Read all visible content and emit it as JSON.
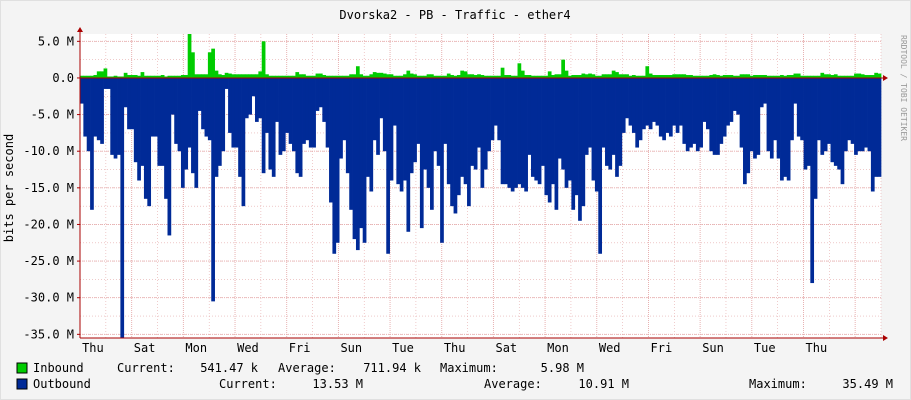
{
  "chart_data": {
    "type": "area",
    "title": "Dvorska2 - PB - Traffic - ether4",
    "ylabel": "bits per second",
    "watermark": "RRDTOOL / TOBI OETIKER",
    "ylim": [
      -35.5,
      6.0
    ],
    "y_ticks": [
      {
        "value": 5.0,
        "label": "5.0 M"
      },
      {
        "value": 0.0,
        "label": "0.0"
      },
      {
        "value": -5.0,
        "label": "-5.0 M"
      },
      {
        "value": -10.0,
        "label": "-10.0 M"
      },
      {
        "value": -15.0,
        "label": "-15.0 M"
      },
      {
        "value": -20.0,
        "label": "-20.0 M"
      },
      {
        "value": -25.0,
        "label": "-25.0 M"
      },
      {
        "value": -30.0,
        "label": "-30.0 M"
      },
      {
        "value": -35.0,
        "label": "-35.0 M"
      }
    ],
    "x_ticks": [
      "Thu",
      "Sat",
      "Mon",
      "Wed",
      "Fri",
      "Sun",
      "Tue",
      "Thu",
      "Sat",
      "Mon",
      "Wed",
      "Fri",
      "Sun",
      "Tue",
      "Thu"
    ],
    "colors": {
      "inbound": "#00cc00",
      "outbound": "#002a97",
      "grid": "#e5aaaa",
      "axis": "#aa0000",
      "bg": "#ffffff"
    },
    "series": [
      {
        "name": "Inbound",
        "values": [
          0.3,
          0.3,
          0.3,
          0.3,
          0.4,
          0.9,
          0.9,
          1.3,
          0.2,
          0.2,
          0.3,
          0.2,
          0.2,
          0.7,
          0.4,
          0.4,
          0.4,
          0.3,
          0.8,
          0.3,
          0.3,
          0.3,
          0.3,
          0.3,
          0.4,
          0.2,
          0.3,
          0.3,
          0.3,
          0.3,
          0.4,
          0.4,
          6.0,
          3.5,
          0.5,
          0.5,
          0.5,
          0.5,
          3.5,
          4.0,
          1.0,
          0.5,
          0.4,
          0.7,
          0.6,
          0.5,
          0.5,
          0.5,
          0.5,
          0.5,
          0.5,
          0.5,
          0.5,
          0.9,
          5.0,
          0.5,
          0.3,
          0.3,
          0.3,
          0.3,
          0.3,
          0.3,
          0.3,
          0.3,
          0.8,
          0.5,
          0.5,
          0.3,
          0.3,
          0.3,
          0.6,
          0.6,
          0.4,
          0.3,
          0.3,
          0.3,
          0.3,
          0.3,
          0.3,
          0.3,
          0.5,
          0.5,
          1.6,
          0.5,
          0.3,
          0.3,
          0.5,
          0.8,
          0.7,
          0.7,
          0.6,
          0.5,
          0.5,
          0.3,
          0.3,
          0.3,
          0.5,
          1.0,
          0.6,
          0.5,
          0.3,
          0.3,
          0.3,
          0.5,
          0.5,
          0.3,
          0.3,
          0.3,
          0.3,
          0.6,
          0.4,
          0.3,
          0.4,
          1.0,
          0.9,
          0.5,
          0.5,
          0.4,
          0.5,
          0.4,
          0.3,
          0.3,
          0.3,
          0.3,
          0.3,
          1.4,
          0.4,
          0.4,
          0.3,
          0.3,
          2.0,
          1.0,
          0.4,
          0.4,
          0.3,
          0.3,
          0.3,
          0.3,
          0.3,
          0.9,
          0.4,
          0.5,
          0.5,
          2.5,
          1.0,
          0.3,
          0.4,
          0.4,
          0.4,
          0.6,
          0.5,
          0.6,
          0.5,
          0.3,
          0.3,
          0.5,
          0.5,
          0.5,
          1.0,
          0.8,
          0.5,
          0.5,
          0.5,
          0.3,
          0.4,
          0.3,
          0.3,
          0.3,
          1.6,
          0.6,
          0.4,
          0.4,
          0.4,
          0.4,
          0.4,
          0.4,
          0.5,
          0.5,
          0.5,
          0.5,
          0.4,
          0.4,
          0.3,
          0.3,
          0.3,
          0.3,
          0.3,
          0.4,
          0.5,
          0.4,
          0.3,
          0.4,
          0.4,
          0.4,
          0.3,
          0.3,
          0.5,
          0.5,
          0.5,
          0.3,
          0.4,
          0.4,
          0.4,
          0.4,
          0.3,
          0.3,
          0.3,
          0.3,
          0.4,
          0.3,
          0.4,
          0.4,
          0.6,
          0.6,
          0.3,
          0.3,
          0.3,
          0.3,
          0.3,
          0.3,
          0.7,
          0.5,
          0.5,
          0.4,
          0.5,
          0.3,
          0.3,
          0.3,
          0.3,
          0.3,
          0.6,
          0.6,
          0.5,
          0.4,
          0.4,
          0.4,
          0.7,
          0.6,
          0.3,
          0.3,
          0.3,
          0.3,
          0.3,
          0.3,
          0.3,
          0.5,
          0.7,
          0.6,
          0.5,
          0.5,
          0.3,
          0.3
        ]
      },
      {
        "name": "Outbound",
        "values": [
          -3.5,
          -8.0,
          -10.0,
          -18.0,
          -8.0,
          -8.5,
          -9.0,
          -1.5,
          -1.5,
          -10.5,
          -11.0,
          -10.5,
          -35.5,
          -4.0,
          -7.0,
          -7.0,
          -11.5,
          -14.0,
          -12.0,
          -16.5,
          -17.5,
          -8.0,
          -8.0,
          -12.0,
          -12.0,
          -16.5,
          -21.5,
          -5.0,
          -9.0,
          -10.0,
          -15.0,
          -12.5,
          -9.5,
          -13.0,
          -15.0,
          -4.5,
          -7.0,
          -8.0,
          -8.5,
          -30.5,
          -13.5,
          -12.0,
          -10.0,
          -1.5,
          -7.5,
          -9.5,
          -9.5,
          -13.5,
          -17.5,
          -5.5,
          -5.0,
          -2.5,
          -6.0,
          -5.5,
          -13.0,
          -7.5,
          -12.5,
          -13.5,
          -6.0,
          -10.5,
          -10.0,
          -7.5,
          -9.0,
          -10.0,
          -13.0,
          -13.5,
          -9.0,
          -8.5,
          -9.5,
          -9.5,
          -4.5,
          -4.0,
          -6.0,
          -9.5,
          -17.0,
          -24.0,
          -22.5,
          -11.0,
          -8.5,
          -13.0,
          -18.0,
          -22.0,
          -23.5,
          -20.5,
          -22.5,
          -13.5,
          -15.5,
          -8.5,
          -10.5,
          -5.5,
          -10.0,
          -24.0,
          -14.0,
          -6.5,
          -14.5,
          -15.5,
          -14.0,
          -21.0,
          -13.0,
          -11.5,
          -9.0,
          -20.5,
          -12.5,
          -15.0,
          -18.0,
          -10.0,
          -12.0,
          -22.5,
          -9.0,
          -14.5,
          -17.5,
          -18.5,
          -16.0,
          -13.5,
          -14.5,
          -17.5,
          -12.0,
          -12.5,
          -9.5,
          -15.0,
          -12.5,
          -10.0,
          -8.5,
          -6.5,
          -8.5,
          -14.5,
          -14.5,
          -15.0,
          -15.5,
          -15.0,
          -14.5,
          -15.0,
          -15.5,
          -10.5,
          -13.5,
          -14.0,
          -14.5,
          -12.0,
          -16.0,
          -17.0,
          -14.5,
          -18.0,
          -11.0,
          -12.5,
          -15.0,
          -14.0,
          -18.0,
          -16.0,
          -19.5,
          -17.5,
          -10.5,
          -9.5,
          -14.0,
          -15.5,
          -24.0,
          -9.5,
          -12.0,
          -12.5,
          -10.5,
          -13.5,
          -12.0,
          -7.5,
          -5.5,
          -6.5,
          -7.5,
          -9.5,
          -8.5,
          -7.0,
          -6.5,
          -7.0,
          -6.0,
          -6.5,
          -8.0,
          -8.5,
          -7.5,
          -8.0,
          -6.5,
          -7.5,
          -6.5,
          -9.0,
          -10.0,
          -9.5,
          -9.0,
          -10.0,
          -9.5,
          -6.0,
          -7.0,
          -10.0,
          -10.5,
          -10.5,
          -9.0,
          -8.0,
          -6.5,
          -6.0,
          -4.5,
          -5.0,
          -9.5,
          -14.5,
          -13.0,
          -10.0,
          -11.0,
          -10.5,
          -4.0,
          -3.5,
          -10.0,
          -11.0,
          -8.5,
          -11.0,
          -14.0,
          -13.5,
          -14.0,
          -8.5,
          -3.5,
          -8.0,
          -8.5,
          -12.5,
          -12.0,
          -28.0,
          -16.5,
          -8.5,
          -10.5,
          -10.0,
          -9.0,
          -11.5,
          -12.0,
          -12.5,
          -14.5,
          -10.0,
          -8.5,
          -9.0,
          -10.5,
          -10.0,
          -10.0,
          -9.5,
          -10.0,
          -15.5,
          -13.5,
          -13.5
        ]
      }
    ],
    "legend": [
      {
        "name": "Inbound",
        "current": "541.47 k",
        "average": "711.94 k",
        "maximum": "5.98 M"
      },
      {
        "name": "Outbound",
        "current": "13.53 M",
        "average": "10.91 M",
        "maximum": "35.49 M"
      }
    ],
    "legend_labels": {
      "current": "Current:",
      "average": "Average:",
      "maximum": "Maximum:"
    }
  }
}
